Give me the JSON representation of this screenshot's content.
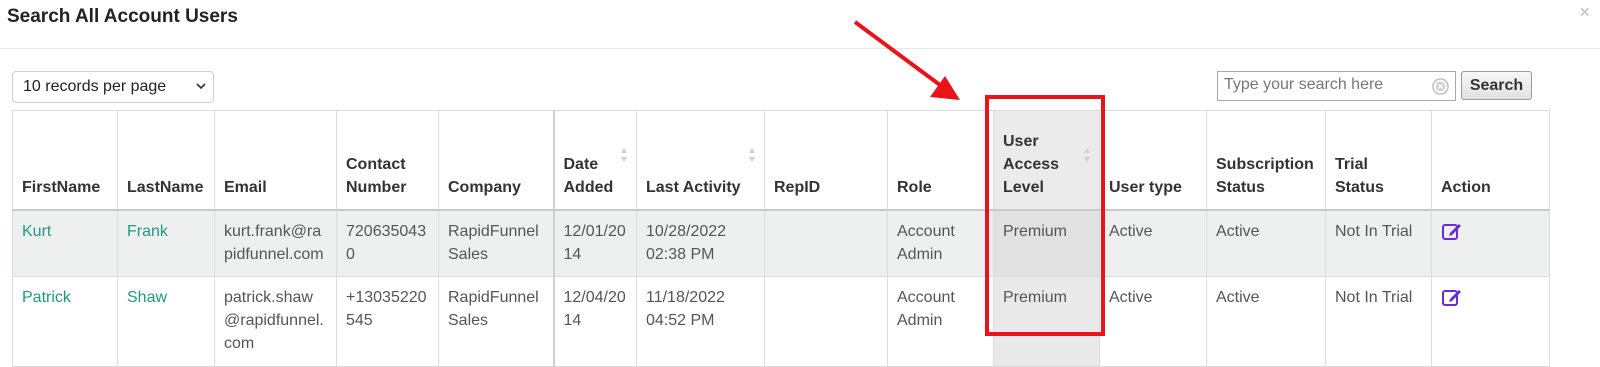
{
  "modal": {
    "title": "Search All Account Users",
    "close_icon": "×"
  },
  "toolbar": {
    "records_per_page": "10 records per page",
    "search_placeholder": "Type your search here",
    "search_button": "Search"
  },
  "table": {
    "headers": [
      [
        "FirstName"
      ],
      [
        "LastName"
      ],
      [
        "Email"
      ],
      [
        "Contact",
        "Number"
      ],
      [
        "Company"
      ],
      [
        "Date",
        "Added"
      ],
      [
        "Last Activity"
      ],
      [
        "RepID"
      ],
      [
        "Role"
      ],
      [
        "User",
        "Access",
        "Level"
      ],
      [
        "User type"
      ],
      [
        "Subscription",
        "Status"
      ],
      [
        "Trial",
        "Status"
      ],
      [
        "Action"
      ]
    ],
    "rows": [
      {
        "firstname": "Kurt",
        "lastname": "Frank",
        "email": [
          "kurt.frank@ra",
          "pidfunnel.com"
        ],
        "contact": [
          "720635043",
          "0"
        ],
        "company": [
          "RapidFunnel",
          "Sales"
        ],
        "date_added": [
          "12/01/20",
          "14"
        ],
        "last_activity": [
          "10/28/2022",
          "02:38 PM"
        ],
        "repid": "",
        "role": [
          "Account",
          "Admin"
        ],
        "access_level": "Premium",
        "user_type": "Active",
        "subscription_status": "Active",
        "trial_status": "Not In Trial"
      },
      {
        "firstname": "Patrick",
        "lastname": "Shaw",
        "email": [
          "patrick.shaw",
          "@rapidfunnel.",
          "com"
        ],
        "contact": [
          "+13035220",
          "545"
        ],
        "company": [
          "RapidFunnel",
          "Sales"
        ],
        "date_added": [
          "12/04/20",
          "14"
        ],
        "last_activity": [
          "11/18/2022",
          "04:52 PM"
        ],
        "repid": "",
        "role": [
          "Account",
          "Admin"
        ],
        "access_level": "Premium",
        "user_type": "Active",
        "subscription_status": "Active",
        "trial_status": "Not In Trial"
      }
    ]
  },
  "colors": {
    "link": "#1e9b7a",
    "annotation": "#e8141a",
    "edit_icon": "#6c2bd9",
    "row_highlight": "#eef0ef"
  }
}
